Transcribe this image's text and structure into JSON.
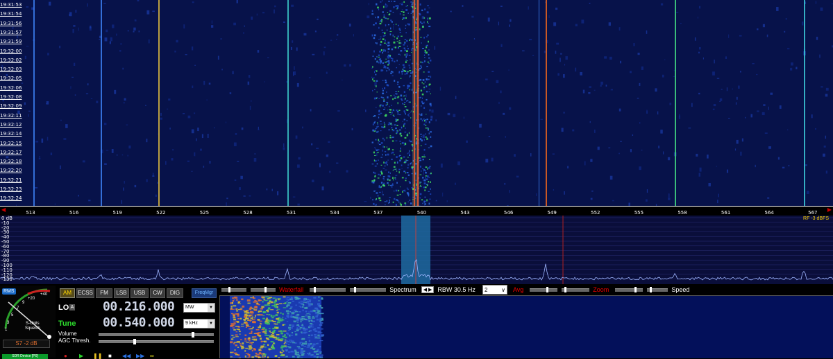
{
  "waterfall": {
    "timestamps": [
      "19:31:53",
      "19:31:54",
      "19:31:56",
      "19:31:57",
      "19:31:59",
      "19:32:00",
      "19:32:02",
      "19:32:03",
      "19:32:05",
      "19:32:06",
      "19:32:08",
      "19:32:09",
      "19:32:11",
      "19:32:12",
      "19:32:14",
      "19:32:15",
      "19:32:17",
      "19:32:18",
      "19:32:20",
      "19:32:21",
      "19:32:23",
      "19:32:24"
    ]
  },
  "ruler": {
    "freqs": [
      "513",
      "516",
      "519",
      "522",
      "525",
      "528",
      "531",
      "534",
      "537",
      "540",
      "543",
      "546",
      "549",
      "552",
      "555",
      "558",
      "561",
      "564",
      "567"
    ]
  },
  "spectrum": {
    "db_labels": [
      "0 dB",
      "-10",
      "-20",
      "-30",
      "-40",
      "-50",
      "-60",
      "-70",
      "-80",
      "-90",
      "-100",
      "-110",
      "-120",
      "-130"
    ],
    "rf_label": "RF -3 dBFS"
  },
  "toolbar": {
    "waterfall_label": "Waterfall",
    "spectrum_label": "Spectrum",
    "rbw_label": "RBW 30.5 Hz",
    "rbw_value": "2",
    "avg_label": "Avg",
    "zoom_label": "Zoom",
    "speed_label": "Speed"
  },
  "smeter": {
    "rms": "RMS",
    "plus40": "+40",
    "plus20": "+20",
    "nine": "9",
    "seven": "7",
    "five": "5",
    "three": "3",
    "one": "1",
    "squelch_line1": "S-Units",
    "squelch_line2": "Squelch",
    "value": "S7 -2 dB",
    "device": "SDR Device [P0]"
  },
  "modes": [
    "AM",
    "ECSS",
    "FM",
    "LSB",
    "USB",
    "CW",
    "DIG"
  ],
  "freqmgr": "FreqMgr",
  "lo": {
    "label": "LO",
    "a": "A",
    "freq": "00.216.000",
    "band": "MW"
  },
  "tune": {
    "label": "Tune",
    "freq": "00.540.000",
    "step": "9 kHz"
  },
  "controls": {
    "volume": "Volume",
    "agc": "AGC Thresh."
  },
  "colors": {
    "waterfall_bg": "#07124a",
    "spectrum_bg": "#0a0e3a",
    "passband": "#1e6aa0",
    "active_mode": "#ffd700",
    "tune": "#2ddd2d",
    "marker_red": "#cc2020"
  }
}
